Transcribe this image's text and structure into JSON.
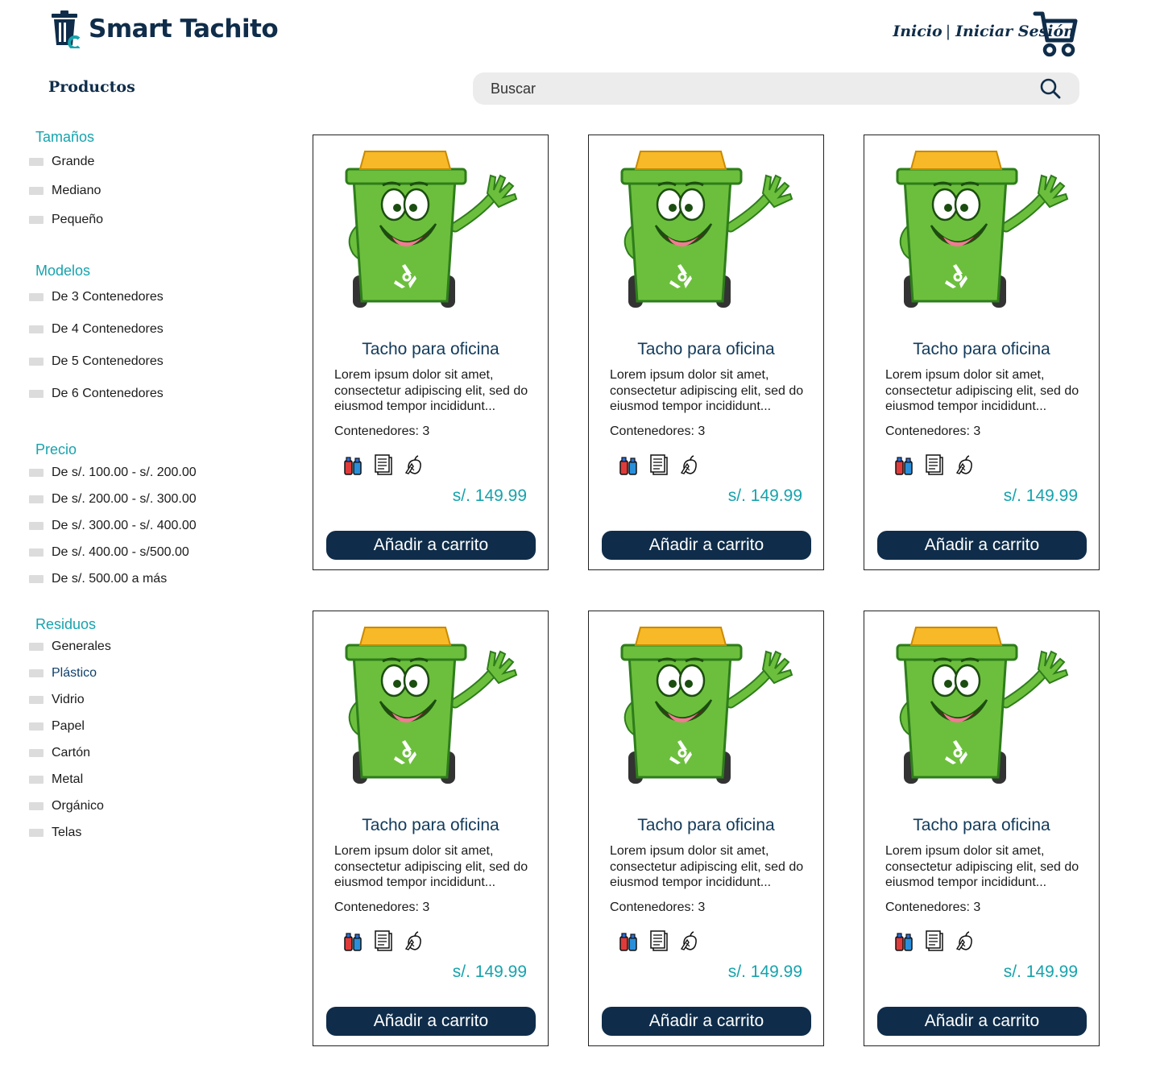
{
  "brand": {
    "name": "Smart Tachito"
  },
  "nav": {
    "home": "Inicio",
    "separator": "|",
    "login": "Iniciar Sesión"
  },
  "section_title": "Productos",
  "search": {
    "placeholder": "Buscar"
  },
  "filters": {
    "sizes": {
      "title": "Tamaños",
      "options": [
        "Grande",
        "Mediano",
        "Pequeño"
      ]
    },
    "models": {
      "title": "Modelos",
      "options": [
        "De 3 Contenedores",
        "De 4 Contenedores",
        "De 5 Contenedores",
        "De 6 Contenedores"
      ]
    },
    "price": {
      "title": "Precio",
      "options": [
        "De s/. 100.00 - s/. 200.00",
        "De s/. 200.00 - s/. 300.00",
        "De s/. 300.00 - s/. 400.00",
        "De s/. 400.00 - s/500.00",
        "De s/. 500.00 a más"
      ]
    },
    "waste": {
      "title": "Residuos",
      "options": [
        "Generales",
        "Plástico",
        "Vidrio",
        "Papel",
        "Cartón",
        "Metal",
        "Orgánico",
        "Telas"
      ]
    }
  },
  "products": [
    {
      "title": "Tacho para oficina",
      "description": "Lorem ipsum dolor sit amet, consectetur adipiscing elit, sed do eiusmod tempor incididunt...",
      "containers": "Contenedores: 3",
      "waste_icons": [
        "bottles-icon",
        "paper-icon",
        "organic-waste-icon"
      ],
      "price": "s/. 149.99",
      "button": "Añadir a carrito"
    },
    {
      "title": "Tacho para oficina",
      "description": "Lorem ipsum dolor sit amet, consectetur adipiscing elit, sed do eiusmod tempor incididunt...",
      "containers": "Contenedores: 3",
      "waste_icons": [
        "bottles-icon",
        "paper-icon",
        "organic-waste-icon"
      ],
      "price": "s/. 149.99",
      "button": "Añadir a carrito"
    },
    {
      "title": "Tacho para oficina",
      "description": "Lorem ipsum dolor sit amet, consectetur adipiscing elit, sed do eiusmod tempor incididunt...",
      "containers": "Contenedores: 3",
      "waste_icons": [
        "bottles-icon",
        "paper-icon",
        "organic-waste-icon"
      ],
      "price": "s/. 149.99",
      "button": "Añadir a carrito"
    },
    {
      "title": "Tacho para oficina",
      "description": "Lorem ipsum dolor sit amet, consectetur adipiscing elit, sed do eiusmod tempor incididunt...",
      "containers": "Contenedores: 3",
      "waste_icons": [
        "bottles-icon",
        "paper-icon",
        "organic-waste-icon"
      ],
      "price": "s/. 149.99",
      "button": "Añadir a carrito"
    },
    {
      "title": "Tacho para oficina",
      "description": "Lorem ipsum dolor sit amet, consectetur adipiscing elit, sed do eiusmod tempor incididunt...",
      "containers": "Contenedores: 3",
      "waste_icons": [
        "bottles-icon",
        "paper-icon",
        "organic-waste-icon"
      ],
      "price": "s/. 149.99",
      "button": "Añadir a carrito"
    },
    {
      "title": "Tacho para oficina",
      "description": "Lorem ipsum dolor sit amet, consectetur adipiscing elit, sed do eiusmod tempor incididunt...",
      "containers": "Contenedores: 3",
      "waste_icons": [
        "bottles-icon",
        "paper-icon",
        "organic-waste-icon"
      ],
      "price": "s/. 149.99",
      "button": "Añadir a carrito"
    }
  ],
  "colors": {
    "navy": "#0f2d4a",
    "teal": "#17a3ad",
    "bin_green": "#6cbf3c",
    "bin_lid": "#f7b928"
  }
}
